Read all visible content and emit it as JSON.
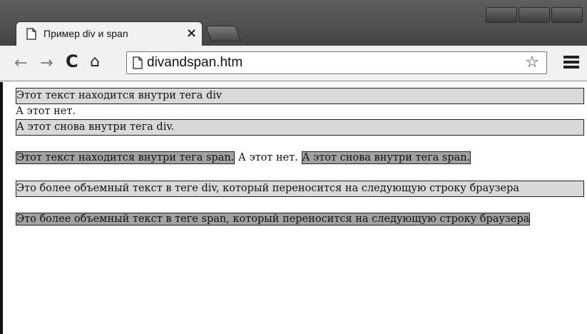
{
  "browser": {
    "tab_title": "Пример div и span",
    "tab_close": "×",
    "url": "divandspan.htm",
    "nav": {
      "back": "←",
      "forward": "→",
      "reload": "C",
      "home": "⌂"
    },
    "star": "☆"
  },
  "page": {
    "div1": "Этот текст находится внутри тега div",
    "plain1": "А этот нет.",
    "div2": "А этот снова внутри тега div.",
    "span1": "Этот текст находится внутри тега span.",
    "plain2": " А этот нет. ",
    "span2": "А этот снова внутри тега span.",
    "div3": "Это более объемный текст в теге div, который переносится на следующую строку браузера",
    "span3": "Это более объемный текст в теге span, который переносится на следующую строку браузера"
  },
  "colors": {
    "div_background": "#d9d9d9",
    "span_background": "#a2a2a2",
    "chrome_dark": "#444444",
    "chrome_light": "#f1f1f1"
  }
}
